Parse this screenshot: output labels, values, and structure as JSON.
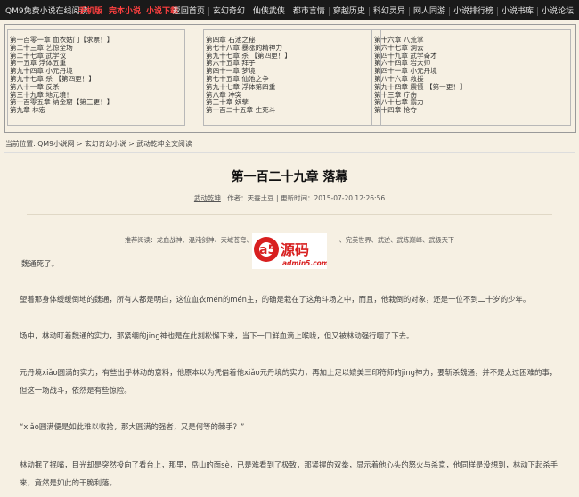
{
  "header": {
    "site_name": "QM9免费小说在线阅读",
    "links_red": [
      "手机版",
      "完本小说",
      "小说下载"
    ],
    "nav": [
      "返回首页",
      "玄幻奇幻",
      "仙侠武侠",
      "都市言情",
      "穿越历史",
      "科幻灵异",
      "网人同游",
      "小说排行榜",
      "小说书库",
      "小说论坛"
    ]
  },
  "chapter_lists": {
    "left": [
      "第一百零一章 血衣姑门【求票！】",
      "第二十三章 艺惊全场",
      "第二十七章 武学议",
      "第十五章 浮体五重",
      "第九十四章 小元丹境",
      "第九十七章 杀 【第四更！】",
      "第八十一章 反杀",
      "第三十九章 地元境！",
      "第一百零五章 纳金窟【第三更！】",
      "第九章 林宏"
    ],
    "middle": [
      "第四章 石池之秘",
      "第七十八章 暴涨的精神力",
      "第九十七章 杀 【第四更！】",
      "第六十五章 拜子",
      "第四十一章 梦境",
      "第七十五章 仙池之争",
      "第九十七章 浮体第四重",
      "第八章 冲突",
      "第三十章 妖孽",
      "第一百二十五章 生死斗"
    ],
    "right": [
      "第十六章 八荒掌",
      "第六十七章 洞云",
      "第四十九章 武学奇才",
      "第六十四章 岩大师",
      "第四十一章 小元丹境",
      "第八十六章 救援",
      "第九十四章 震慑 【第一更！】",
      "第十三章 疗伤",
      "第八十七章 霸力",
      "第十四章 抢夺"
    ]
  },
  "breadcrumb": "当前位置: QM9小说网 > 玄幻奇幻小说 > 武动乾坤全文阅读",
  "chapter": {
    "title": "第一百二十九章 落幕",
    "book_link": "武动乾坤",
    "meta_rest": " | 作者：天蚕土豆 | 更新时间：2015-07-20 12:26:56",
    "recommend": "推荐阅读：龙血战神、混沌剑神、天域苍穹、霸皇、　　　　　　　　　　　、完美世界、武逆、武炼巅峰、武极天下"
  },
  "watermark": {
    "logo_text": "源码",
    "logo_letter": "a5",
    "logo_url": "admin5.com"
  },
  "paragraphs": [
    "魏通死了。",
    "望着那身体缓缓倒地的魏通，所有人都是明白，这位血衣mén的mén主，的确是栽在了这角斗场之中，而且，他栽倒的对象，还是一位不到二十岁的少年。",
    "场中，林动盯着魏通的实力，那紧绷的jing神也是在此刻松懈下来，当下一口鲜血滴上喉咙，但又被林动强行咽了下去。",
    "元丹境xiǎo圆满的实力，有些出乎林动的意料，他原本以为凭借着他xiǎo元丹境的实力，再加上足以媲美三印符师的jing神力，要斩杀魏通，并不是太过困难的事，但这一场战斗，依然是有些惊险。",
    "“xiǎo圆满便是如此难以收拾，那大圆满的强者，又是何等的棘手？”",
    "林动抿了抿嘴，目光却是突然投向了看台上，那里，岳山的面sè，已是难看到了极致，那紧握的双拳，显示着他心头的怒火与杀意，他同样是没想到，林动下起杀手来，竟然是如此的干脆利落。"
  ]
}
